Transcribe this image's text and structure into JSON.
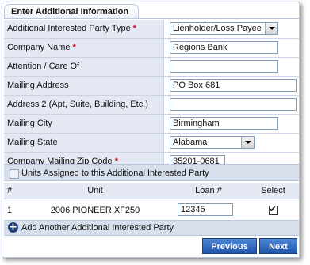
{
  "tab": {
    "title": "Enter Additional Information"
  },
  "form": {
    "party_type": {
      "label": "Additional Interested Party Type",
      "required": "*",
      "value": "Lienholder/Loss Payee"
    },
    "company_name": {
      "label": "Company Name",
      "required": "*",
      "value": "Regions Bank"
    },
    "attention": {
      "label": "Attention / Care Of",
      "value": ""
    },
    "address": {
      "label": "Mailing Address",
      "value": "PO Box 681"
    },
    "address2": {
      "label": "Address 2 (Apt, Suite, Building, Etc.)",
      "value": ""
    },
    "city": {
      "label": "Mailing City",
      "value": "Birmingham"
    },
    "state": {
      "label": "Mailing State",
      "value": "Alabama"
    },
    "zip": {
      "label": "Company Mailing Zip Code",
      "required": "*",
      "value": "35201-0681"
    }
  },
  "units_section": {
    "label": "Units Assigned to this Additional Interested Party"
  },
  "units_table": {
    "headers": {
      "num": "#",
      "unit": "Unit",
      "loan": "Loan #",
      "select": "Select"
    },
    "rows": [
      {
        "num": "1",
        "unit": "2006 PIONEER XF250",
        "loan": "12345",
        "selected": true
      }
    ]
  },
  "add_party": {
    "label": "Add Another Additional Interested Party"
  },
  "buttons": {
    "previous": "Previous",
    "next": "Next"
  },
  "colors": {
    "label_bg": "#e3e8f3",
    "section_bg": "#d8dfec",
    "button": "#2b63bd",
    "required": "#c8102e"
  }
}
